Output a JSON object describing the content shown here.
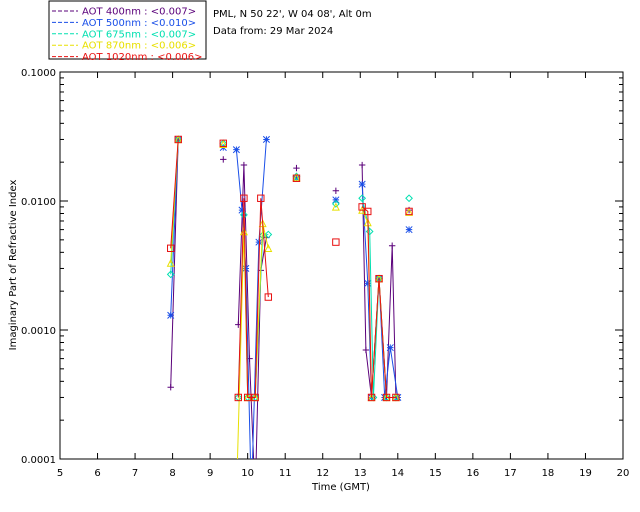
{
  "chart_data": {
    "type": "scatter",
    "title_lines": [
      "PML, N 50 22', W 04 08', Alt 0m",
      "Data from: 29 Mar 2024"
    ],
    "xlabel": "Time (GMT)",
    "ylabel": "Imaginary Part of Refractive Index",
    "xlim": [
      5,
      20
    ],
    "ylim": [
      0.0001,
      0.1
    ],
    "yscale": "log",
    "x_ticks": [
      "5",
      "6",
      "7",
      "8",
      "9",
      "10",
      "11",
      "12",
      "13",
      "14",
      "15",
      "16",
      "17",
      "18",
      "19",
      "20"
    ],
    "y_ticks": [
      {
        "v": 0.0001,
        "label": "0.0001"
      },
      {
        "v": 0.001,
        "label": "0.0010"
      },
      {
        "v": 0.01,
        "label": "0.0100"
      },
      {
        "v": 0.1,
        "label": "0.1000"
      }
    ],
    "legend_position": "top-left",
    "grid": false,
    "series": [
      {
        "name": "AOT  400nm : <0.007>",
        "color": "#5a007a",
        "marker": "plus",
        "segments": [
          [
            [
              7.95,
              0.00036
            ],
            [
              8.15,
              0.03
            ]
          ],
          [
            [
              9.75,
              0.0011
            ],
            [
              9.9,
              0.019
            ],
            [
              10.05,
              0.0006
            ],
            [
              10.2,
              5e-05
            ],
            [
              10.35,
              0.0029
            ],
            [
              10.5,
              0.0052
            ]
          ],
          [
            [
              13.05,
              0.019
            ],
            [
              13.15,
              0.0007
            ],
            [
              13.3,
              0.0003
            ],
            [
              13.5,
              0.0025
            ],
            [
              13.7,
              0.0003
            ],
            [
              13.85,
              0.0045
            ],
            [
              13.95,
              0.0003
            ]
          ]
        ],
        "points": [
          [
            9.35,
            0.021
          ],
          [
            11.3,
            0.018
          ],
          [
            12.35,
            0.012
          ],
          [
            14.3,
            0.0085
          ]
        ]
      },
      {
        "name": "AOT  500nm : <0.010>",
        "color": "#1a4fe8",
        "marker": "asterisk",
        "segments": [
          [
            [
              7.95,
              0.0013
            ],
            [
              8.15,
              0.03
            ]
          ],
          [
            [
              9.7,
              0.025
            ],
            [
              9.85,
              0.0085
            ],
            [
              9.95,
              0.003
            ],
            [
              10.1,
              5e-05
            ],
            [
              10.3,
              0.0048
            ],
            [
              10.5,
              0.03
            ]
          ],
          [
            [
              13.05,
              0.0135
            ],
            [
              13.2,
              0.0023
            ],
            [
              13.3,
              0.0003
            ],
            [
              13.5,
              0.0025
            ],
            [
              13.65,
              0.0003
            ],
            [
              13.8,
              0.00073
            ],
            [
              14.0,
              0.0003
            ]
          ]
        ],
        "points": [
          [
            9.35,
            0.026
          ],
          [
            11.3,
            0.015
          ],
          [
            12.35,
            0.0102
          ],
          [
            14.3,
            0.006
          ]
        ]
      },
      {
        "name": "AOT  675nm : <0.007>",
        "color": "#00e0b0",
        "marker": "diamond",
        "segments": [
          [
            [
              7.95,
              0.0027
            ],
            [
              8.15,
              0.03
            ]
          ],
          [
            [
              9.75,
              0.0003
            ],
            [
              9.9,
              0.0078
            ],
            [
              10.0,
              0.0003
            ],
            [
              10.2,
              0.0003
            ],
            [
              10.4,
              0.0054
            ],
            [
              10.55,
              0.0055
            ]
          ],
          [
            [
              13.05,
              0.0105
            ],
            [
              13.25,
              0.0058
            ],
            [
              13.35,
              0.0003
            ],
            [
              13.5,
              0.0025
            ],
            [
              13.7,
              0.0003
            ],
            [
              13.95,
              0.0003
            ]
          ]
        ],
        "points": [
          [
            9.35,
            0.028
          ],
          [
            11.3,
            0.0155
          ],
          [
            12.35,
            0.0095
          ],
          [
            14.3,
            0.0105
          ]
        ]
      },
      {
        "name": "AOT  870nm : <0.006>",
        "color": "#e8e000",
        "marker": "triangle",
        "segments": [
          [
            [
              7.95,
              0.0033
            ],
            [
              8.15,
              0.03
            ]
          ],
          [
            [
              9.7,
              5e-05
            ],
            [
              9.9,
              0.0058
            ],
            [
              10.0,
              0.0003
            ],
            [
              10.2,
              0.0003
            ],
            [
              10.4,
              0.0067
            ],
            [
              10.55,
              0.0043
            ]
          ],
          [
            [
              13.05,
              0.0085
            ],
            [
              13.2,
              0.0068
            ],
            [
              13.3,
              0.0003
            ],
            [
              13.5,
              0.0025
            ],
            [
              13.7,
              0.0003
            ],
            [
              13.95,
              0.0003
            ]
          ]
        ],
        "points": [
          [
            9.35,
            0.0275
          ],
          [
            11.3,
            0.0152
          ],
          [
            12.35,
            0.009
          ],
          [
            14.3,
            0.0082
          ]
        ]
      },
      {
        "name": "AOT 1020nm : <0.006>",
        "color": "#e81010",
        "marker": "square",
        "segments": [
          [
            [
              7.95,
              0.0043
            ],
            [
              8.15,
              0.03
            ]
          ],
          [
            [
              9.75,
              0.0003
            ],
            [
              9.9,
              0.0105
            ],
            [
              10.0,
              0.0003
            ],
            [
              10.2,
              0.0003
            ],
            [
              10.35,
              0.0105
            ],
            [
              10.55,
              0.0018
            ]
          ],
          [
            [
              13.05,
              0.009
            ],
            [
              13.2,
              0.0083
            ],
            [
              13.3,
              0.0003
            ],
            [
              13.5,
              0.0025
            ],
            [
              13.7,
              0.0003
            ],
            [
              13.95,
              0.0003
            ]
          ]
        ],
        "points": [
          [
            9.35,
            0.028
          ],
          [
            11.3,
            0.015
          ],
          [
            12.35,
            0.0048
          ],
          [
            14.3,
            0.0083
          ]
        ]
      }
    ]
  }
}
